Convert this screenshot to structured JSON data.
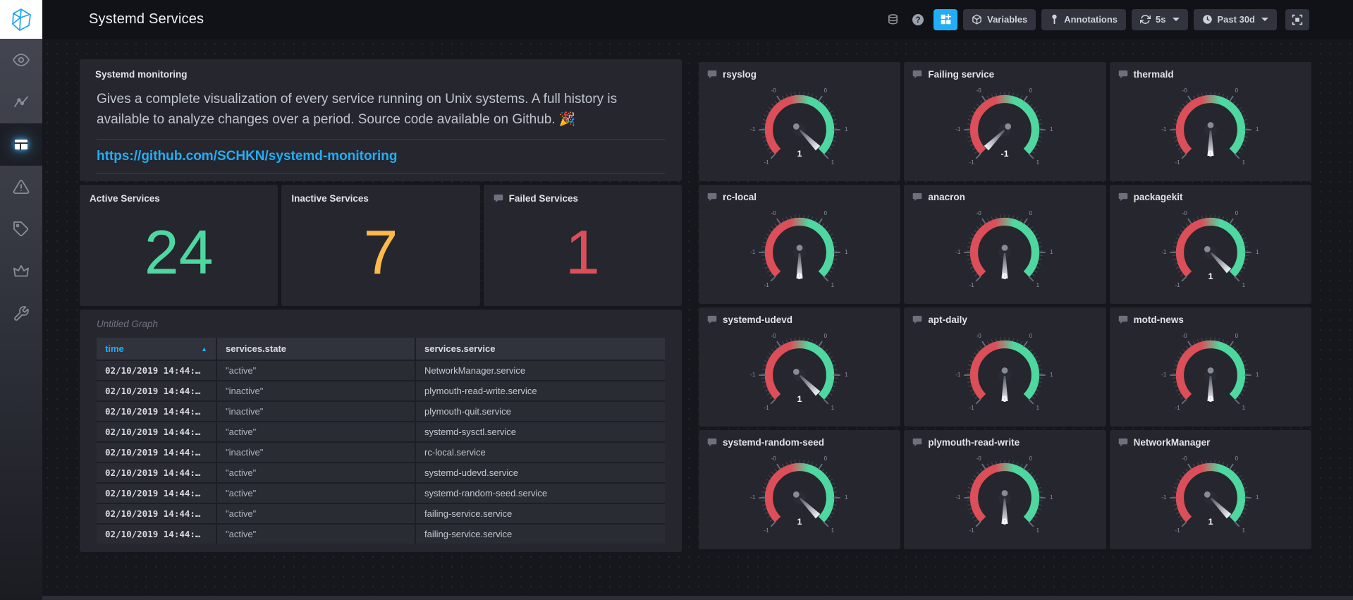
{
  "theme": {
    "accent": "#22adf6",
    "gauge_red": "#dc4e58",
    "gauge_green": "#4ed8a0",
    "stat_green": "#4ed8a0",
    "stat_orange": "#ffb94a",
    "stat_red": "#dc4e58"
  },
  "sidebar": {
    "items": [
      {
        "icon": "eye-icon",
        "active": false
      },
      {
        "icon": "graph-pulse-icon",
        "active": false
      },
      {
        "icon": "dashboards-grid-icon",
        "active": true
      },
      {
        "icon": "alert-triangle-icon",
        "active": false
      },
      {
        "icon": "tags-icon",
        "active": false
      },
      {
        "icon": "crown-icon",
        "active": false
      },
      {
        "icon": "wrench-icon",
        "active": false
      }
    ]
  },
  "nav": {
    "title": "Systemd Services",
    "toolbar": {
      "variables_label": "Variables",
      "annotations_label": "Annotations",
      "refresh_value": "5s",
      "time_range_value": "Past 30d"
    }
  },
  "panels": {
    "text_panel": {
      "title": "Systemd monitoring",
      "body": "Gives a complete visualization of every service running on Unix systems. A full history is available to analyze changes over a period. Source code available on Github. 🎉",
      "link": "https://github.com/SCHKN/systemd-monitoring"
    },
    "stats": [
      {
        "title": "Active Services",
        "value": "24",
        "color": "#4ed8a0"
      },
      {
        "title": "Inactive Services",
        "value": "7",
        "color": "#ffb94a"
      },
      {
        "title": "Failed Services",
        "value": "1",
        "color": "#dc4e58"
      }
    ],
    "table_panel": {
      "title": "Untitled Graph",
      "columns": [
        "time",
        "services.state",
        "services.service"
      ],
      "sort": {
        "column": "time",
        "direction": "asc"
      },
      "rows": [
        [
          "02/10/2019 14:44:…",
          "\"active\"",
          "NetworkManager.service"
        ],
        [
          "02/10/2019 14:44:…",
          "\"inactive\"",
          "plymouth-read-write.service"
        ],
        [
          "02/10/2019 14:44:…",
          "\"inactive\"",
          "plymouth-quit.service"
        ],
        [
          "02/10/2019 14:44:…",
          "\"active\"",
          "systemd-sysctl.service"
        ],
        [
          "02/10/2019 14:44:…",
          "\"inactive\"",
          "rc-local.service"
        ],
        [
          "02/10/2019 14:44:…",
          "\"active\"",
          "systemd-udevd.service"
        ],
        [
          "02/10/2019 14:44:…",
          "\"active\"",
          "systemd-random-seed.service"
        ],
        [
          "02/10/2019 14:44:…",
          "\"active\"",
          "failing-service.service"
        ],
        [
          "02/10/2019 14:44:…",
          "\"active\"",
          "failing-service.service"
        ]
      ]
    },
    "gauge_scale": {
      "min": -1,
      "max": 1,
      "major_ticks": [
        {
          "angle": -135,
          "label": "-1"
        },
        {
          "angle": -90,
          "label": "-1"
        },
        {
          "angle": -33.75,
          "label": "-0"
        },
        {
          "angle": 33.75,
          "label": "0"
        },
        {
          "angle": 90,
          "label": "1"
        },
        {
          "angle": 135,
          "label": "1"
        }
      ]
    },
    "gauges": [
      {
        "title": "rsyslog",
        "value": 1
      },
      {
        "title": "Failing service",
        "value": -1
      },
      {
        "title": "thermald",
        "value": 0
      },
      {
        "title": "rc-local",
        "value": 0
      },
      {
        "title": "anacron",
        "value": 0
      },
      {
        "title": "packagekit",
        "value": 1
      },
      {
        "title": "systemd-udevd",
        "value": 1
      },
      {
        "title": "apt-daily",
        "value": 0
      },
      {
        "title": "motd-news",
        "value": 0
      },
      {
        "title": "systemd-random-seed",
        "value": 1
      },
      {
        "title": "plymouth-read-write",
        "value": 0
      },
      {
        "title": "NetworkManager",
        "value": 1
      }
    ]
  }
}
